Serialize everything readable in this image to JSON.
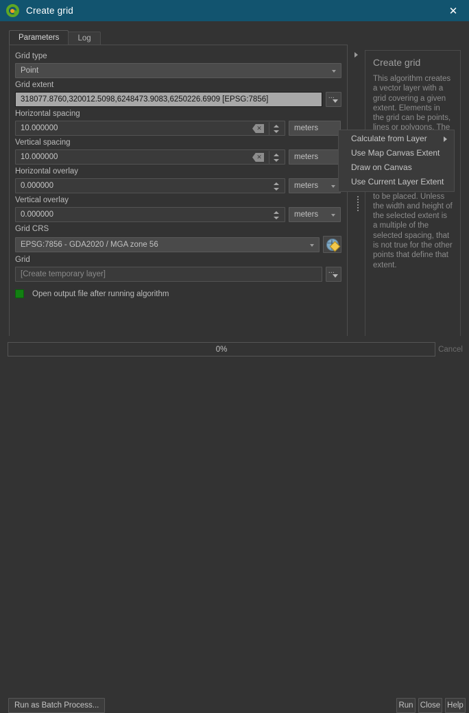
{
  "window": {
    "title": "Create grid",
    "logo_icon": "qgis-logo-icon",
    "close_icon": "close-icon"
  },
  "tabs": [
    {
      "label": "Parameters",
      "active": true
    },
    {
      "label": "Log",
      "active": false
    }
  ],
  "parameters": {
    "grid_type": {
      "label": "Grid type",
      "value": "Point"
    },
    "grid_extent": {
      "label": "Grid extent",
      "value": "318077.8760,320012.5098,6248473.9083,6250226.6909 [EPSG:7856]",
      "button_icon": "dropdown-dots-icon"
    },
    "horizontal_spacing": {
      "label": "Horizontal spacing",
      "value": "10.000000",
      "unit": "meters"
    },
    "vertical_spacing": {
      "label": "Vertical spacing",
      "value": "10.000000",
      "unit": "meters"
    },
    "horizontal_overlay": {
      "label": "Horizontal overlay",
      "value": "0.000000",
      "unit": "meters"
    },
    "vertical_overlay": {
      "label": "Vertical overlay",
      "value": "0.000000",
      "unit": "meters"
    },
    "grid_crs": {
      "label": "Grid CRS",
      "value": "EPSG:7856 - GDA2020 / MGA zone 56",
      "button_icon": "select-crs-globe-icon"
    },
    "grid_output": {
      "label": "Grid",
      "placeholder": "[Create temporary layer]",
      "value": "",
      "button_icon": "browse-dots-icon"
    },
    "open_output": {
      "label": "Open output file after running algorithm",
      "checked": true,
      "check_color": "#128012"
    }
  },
  "context_menu": {
    "items": [
      {
        "label": "Calculate from Layer",
        "has_submenu": true
      },
      {
        "label": "Use Map Canvas Extent",
        "has_submenu": false
      },
      {
        "label": "Draw on Canvas",
        "has_submenu": false
      },
      {
        "label": "Use Current Layer Extent",
        "has_submenu": false
      }
    ]
  },
  "help_panel": {
    "title": "Create grid",
    "body": "This algorithm creates a vector layer with a grid covering a given extent. Elements in the grid can be points, lines or polygons. The size and/or placement of each element in the grid is defined using a point. That means that, at that point, an element is guaranteed to be placed. Unless the width and height of the selected extent is a multiple of the selected spacing, that is not true for the other points that define that extent."
  },
  "bottom": {
    "progress_text": "0%",
    "progress_percent": 0,
    "cancel_label": "Cancel",
    "batch_label": "Run as Batch Process...",
    "run_label": "Run",
    "close_label": "Close",
    "help_label": "Help"
  },
  "colors": {
    "titlebar": "#12546f",
    "background": "#333333",
    "accent_green": "#5fa724"
  }
}
